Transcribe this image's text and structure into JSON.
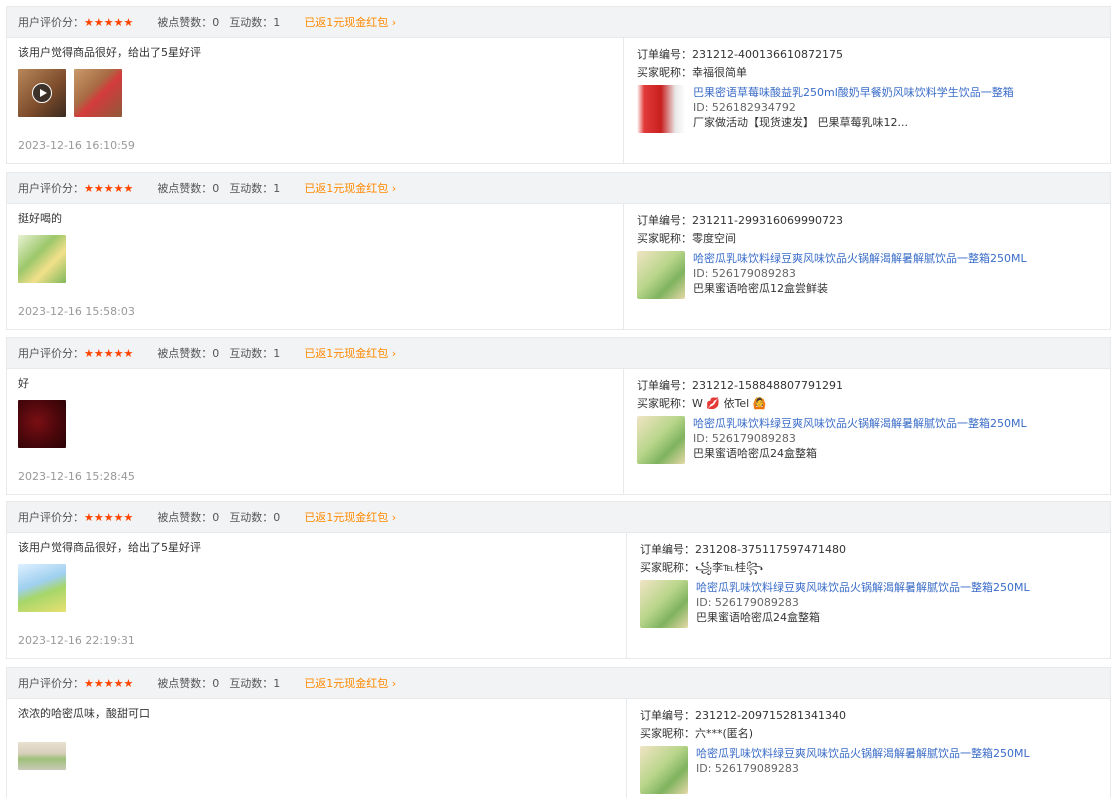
{
  "reviews": [
    {
      "header": {
        "score_label": "用户评价分：",
        "stars": "★★★★★",
        "likes": "被点赞数：0",
        "interactions": "互动数：1",
        "cash": "已返1元现金红包 ›"
      },
      "text": "该用户觉得商品很好，给出了5星好评",
      "thumb_icons": [
        "video-thumbnail-icon",
        "photo-thumbnail-icon"
      ],
      "time": "2023-12-16 16:10:59",
      "order_label": "订单编号：",
      "order_no": "231212-400136610872175",
      "buyer_label": "买家昵称：",
      "buyer": "幸福很简单",
      "product": {
        "title": "巴果密语草莓味酸益乳250ml酸奶早餐奶风味饮料学生饮品一整箱",
        "id": "ID: 526182934792",
        "sku": "厂家做活动【现货速发】 巴果草莓乳味12..."
      }
    },
    {
      "header": {
        "score_label": "用户评价分：",
        "stars": "★★★★★",
        "likes": "被点赞数：0",
        "interactions": "互动数：1",
        "cash": "已返1元现金红包 ›"
      },
      "text": "挺好喝的",
      "thumb_icons": [
        "photo-thumbnail-icon"
      ],
      "time": "2023-12-16 15:58:03",
      "order_label": "订单编号：",
      "order_no": "231211-299316069990723",
      "buyer_label": "买家昵称：",
      "buyer": "零度空间",
      "product": {
        "title": "哈密瓜乳味饮料绿豆爽风味饮品火锅解渴解暑解腻饮品一整箱250ML",
        "id": "ID: 526179089283",
        "sku": "巴果蜜语哈密瓜12盒尝鲜装"
      }
    },
    {
      "header": {
        "score_label": "用户评价分：",
        "stars": "★★★★★",
        "likes": "被点赞数：0",
        "interactions": "互动数：1",
        "cash": "已返1元现金红包 ›"
      },
      "text": "好",
      "thumb_icons": [
        "photo-thumbnail-icon"
      ],
      "time": "2023-12-16 15:28:45",
      "order_label": "订单编号：",
      "order_no": "231212-158848807791291",
      "buyer_label": "买家昵称：",
      "buyer": "W 💋 依Tel 🙆",
      "product": {
        "title": "哈密瓜乳味饮料绿豆爽风味饮品火锅解渴解暑解腻饮品一整箱250ML",
        "id": "ID: 526179089283",
        "sku": "巴果蜜语哈密瓜24盒整箱"
      }
    },
    {
      "header": {
        "score_label": "用户评价分：",
        "stars": "★★★★★",
        "likes": "被点赞数：0",
        "interactions": "互动数：0",
        "cash": "已返1元现金红包 ›"
      },
      "text": "该用户觉得商品很好，给出了5星好评",
      "thumb_icons": [
        "photo-thumbnail-icon"
      ],
      "time": "2023-12-16 22:19:31",
      "order_label": "订单编号：",
      "order_no": "231208-375117597471480",
      "buyer_label": "买家昵称：",
      "buyer": "꧁李℡桂꧂",
      "product": {
        "title": "哈密瓜乳味饮料绿豆爽风味饮品火锅解渴解暑解腻饮品一整箱250ML",
        "id": "ID: 526179089283",
        "sku": "巴果蜜语哈密瓜24盒整箱"
      }
    },
    {
      "header": {
        "score_label": "用户评价分：",
        "stars": "★★★★★",
        "likes": "被点赞数：0",
        "interactions": "互动数：1",
        "cash": "已返1元现金红包 ›"
      },
      "text": "浓浓的哈密瓜味，酸甜可口",
      "thumb_icons": [
        "photo-thumbnail-icon"
      ],
      "time": "",
      "order_label": "订单编号：",
      "order_no": "231212-209715281341340",
      "buyer_label": "买家昵称：",
      "buyer": "六***(匿名)",
      "product": {
        "title": "哈密瓜乳味饮料绿豆爽风味饮品火锅解渴解暑解腻饮品一整箱250ML",
        "id": "ID: 526179089283",
        "sku": ""
      }
    }
  ]
}
